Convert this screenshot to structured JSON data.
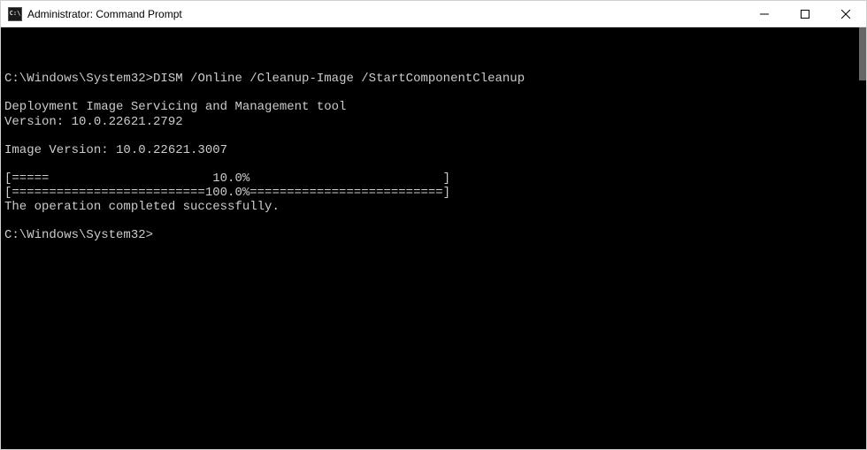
{
  "window": {
    "title": "Administrator: Command Prompt"
  },
  "terminal": {
    "line1_prompt": "C:\\Windows\\System32>",
    "line1_command": "DISM /Online /Cleanup-Image /StartComponentCleanup",
    "blank1": "",
    "tool_name": "Deployment Image Servicing and Management tool",
    "tool_version": "Version: 10.0.22621.2792",
    "blank2": "",
    "image_version": "Image Version: 10.0.22621.3007",
    "blank3": "",
    "progress1": "[=====                      10.0%                          ]",
    "progress2": "[==========================100.0%==========================]",
    "complete_msg": "The operation completed successfully.",
    "blank4": "",
    "line2_prompt": "C:\\Windows\\System32>"
  }
}
